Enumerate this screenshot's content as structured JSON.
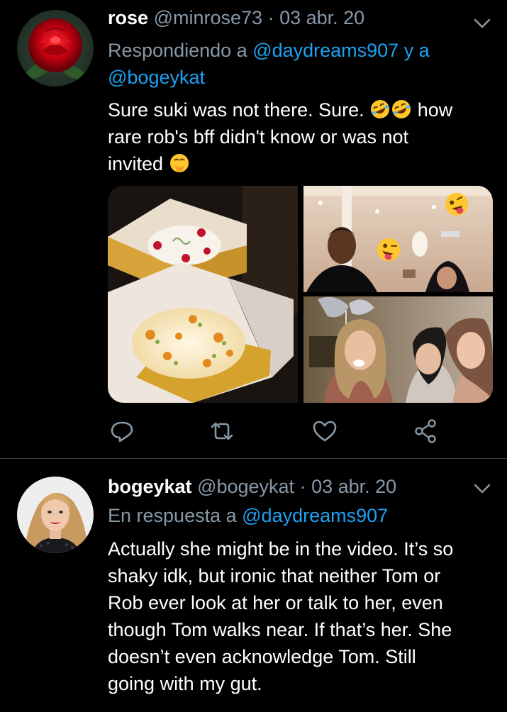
{
  "tweets": [
    {
      "name": "rose",
      "handle": "@minrose73",
      "separator": "·",
      "date": "03 abr. 20",
      "reply_prefix": "Respondiendo a",
      "reply_user1": "@daydreams907",
      "reply_conj": "y a",
      "reply_user2": "@bogeykat",
      "line1_a": "Sure suki was not there. Sure.",
      "line1_b": "how",
      "line2": "rare rob's bff didn't know or was not",
      "line3": "invited",
      "emoji": [
        "rolling-on-floor-laughing",
        "rolling-on-floor-laughing",
        "face-with-hand-over-mouth"
      ],
      "media": [
        "cake-photo",
        "party-photo-man",
        "party-photo-women"
      ],
      "actions": [
        "reply-icon",
        "retweet-icon",
        "like-icon",
        "share-icon"
      ]
    },
    {
      "name": "bogeykat",
      "handle": "@bogeykat",
      "separator": "·",
      "date": "03 abr. 20",
      "reply_prefix": "En respuesta a",
      "reply_user1": "@daydreams907",
      "lines": [
        "Actually she might be in the video. It’s so",
        "shaky idk, but ironic that neither Tom or",
        "Rob ever look at her or talk to her, even",
        "though Tom walks near. If that’s her. She",
        "doesn’t even acknowledge Tom. Still",
        "going with my gut."
      ]
    }
  ],
  "colors": {
    "background": "#000000",
    "secondary": "#8899a6",
    "link": "#1da1f2",
    "divider": "#38444d"
  }
}
